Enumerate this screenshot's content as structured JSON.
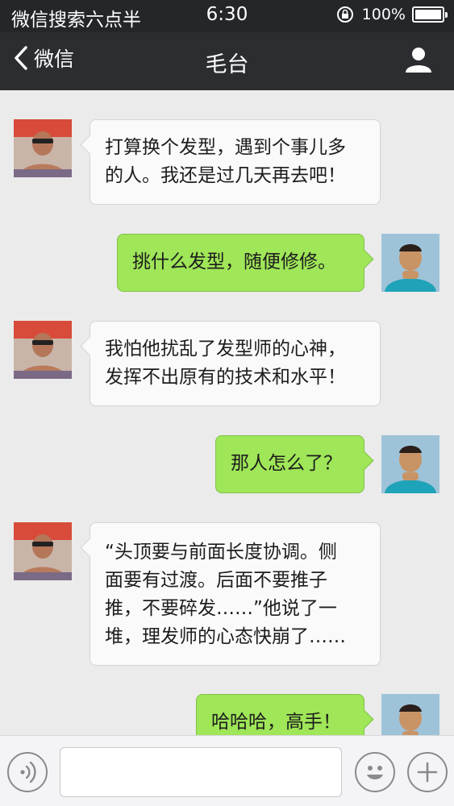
{
  "status_bar": {
    "carrier": "微信搜索六点半",
    "time": "6:30",
    "battery": "100%"
  },
  "nav": {
    "back_label": "微信",
    "title": "毛台",
    "icons": {
      "back": "chevron-left-icon",
      "profile": "person-icon"
    }
  },
  "messages": [
    {
      "side": "in",
      "text": "打算换个发型，遇到个事儿多\n的人。我还是过几天再去吧！"
    },
    {
      "side": "out",
      "text": "挑什么发型，随便修修。"
    },
    {
      "side": "in",
      "text": "我怕他扰乱了发型师的心神，\n发挥不出原有的技术和水平！"
    },
    {
      "side": "out",
      "text": "那人怎么了？"
    },
    {
      "side": "in",
      "text": "“头顶要与前面长度协调。侧\n面要有过渡。后面不要推子\n推，不要碎发……”他说了一\n堆，理发师的心态快崩了……"
    },
    {
      "side": "out",
      "text": "哈哈哈，高手！"
    }
  ],
  "input_bar": {
    "text_value": "",
    "icons": {
      "voice": "voice-icon",
      "emoji": "emoji-icon",
      "more": "plus-icon"
    }
  },
  "colors": {
    "status_bg": "#242629",
    "nav_bg": "#2b2d31",
    "chat_bg": "#ebebeb",
    "bubble_in": "#fafafa",
    "bubble_out": "#9fe658"
  }
}
